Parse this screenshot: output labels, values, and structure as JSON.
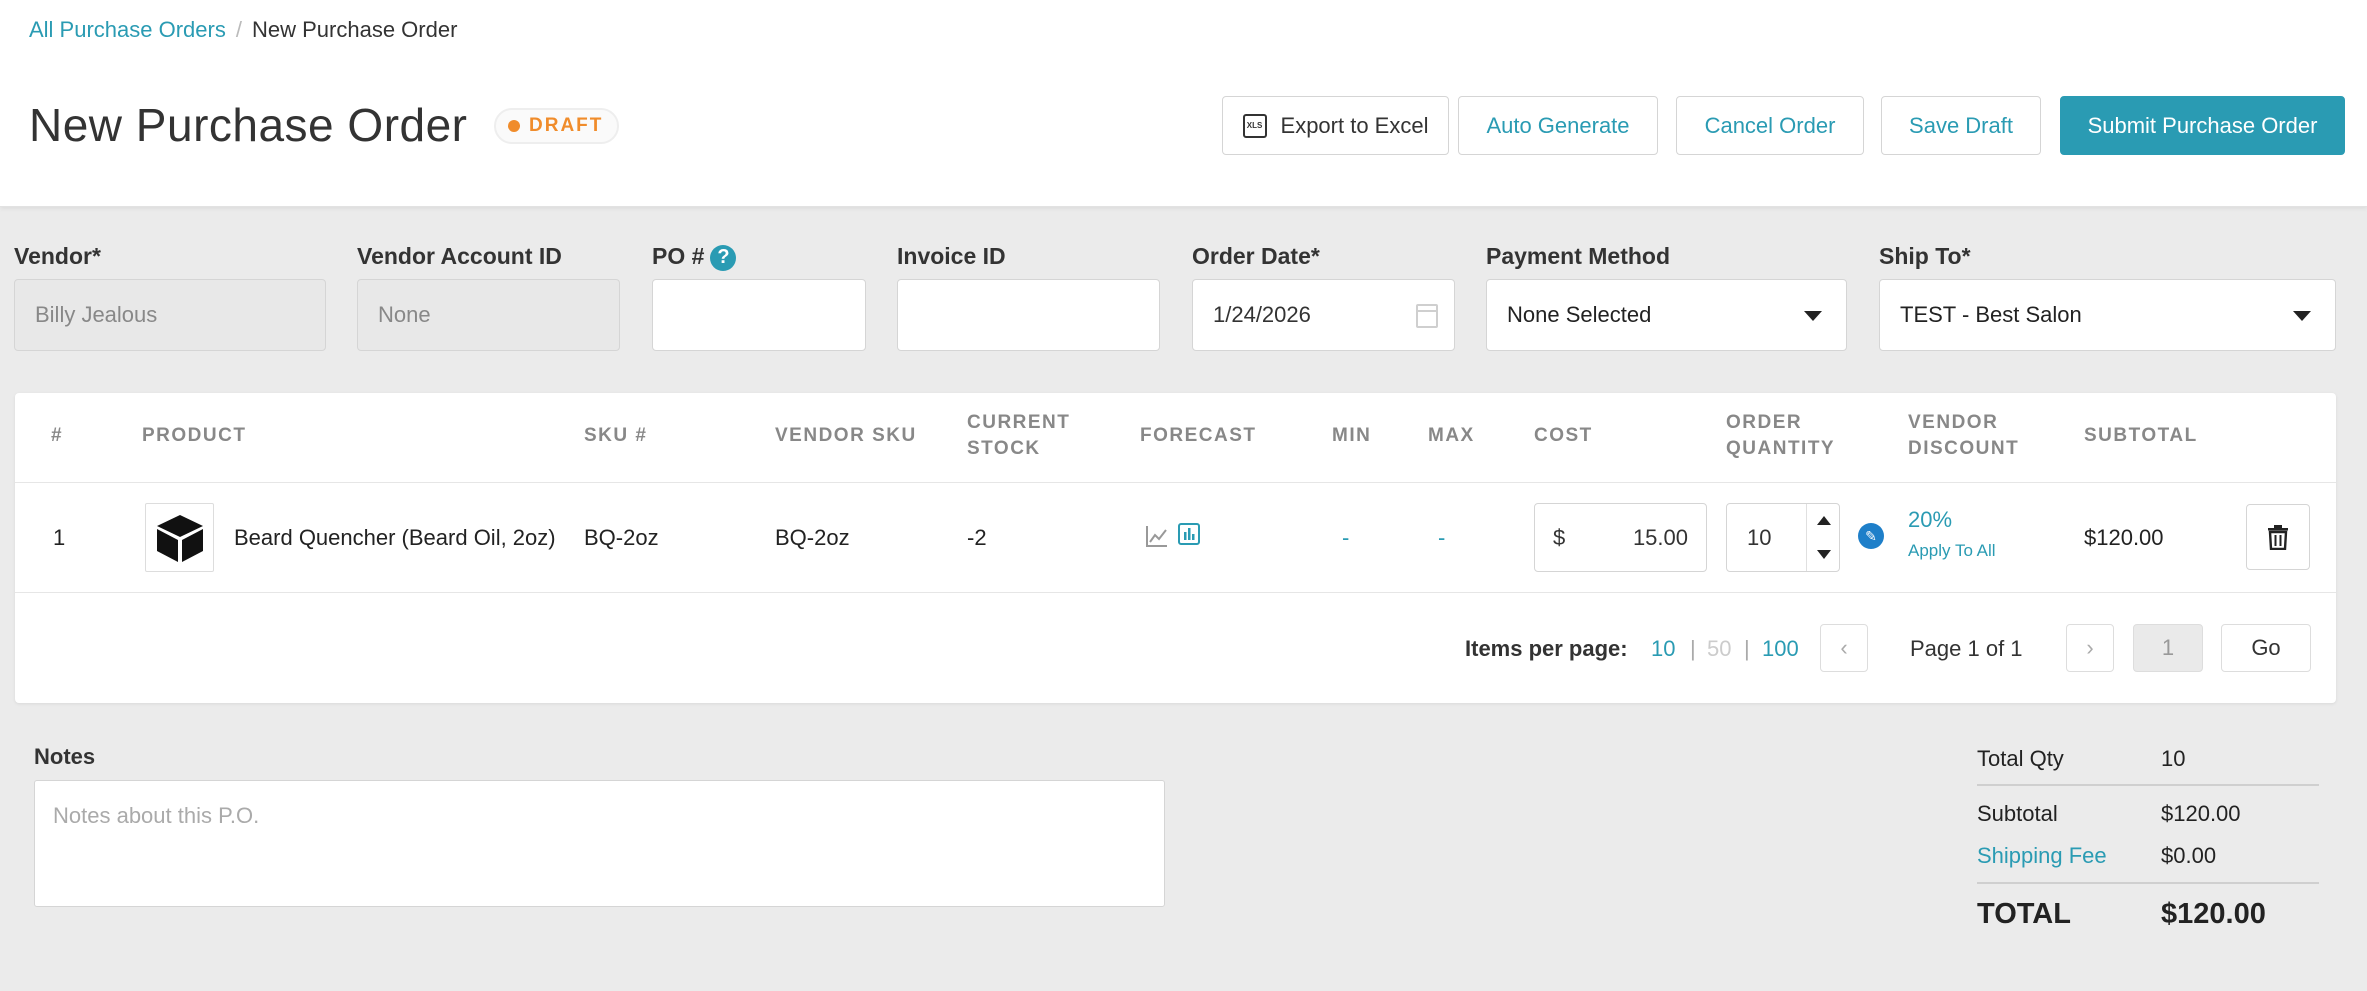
{
  "breadcrumb": {
    "link": "All Purchase Orders",
    "separator": "/",
    "current": "New Purchase Order"
  },
  "page": {
    "title": "New Purchase Order",
    "status": "DRAFT"
  },
  "toolbar": {
    "export": "Export to Excel",
    "auto": "Auto Generate",
    "cancel": "Cancel Order",
    "save": "Save Draft",
    "submit": "Submit Purchase Order"
  },
  "form": {
    "vendor": {
      "label": "Vendor*",
      "value": "Billy Jealous"
    },
    "account": {
      "label": "Vendor Account ID",
      "value": "None"
    },
    "po": {
      "label": "PO #",
      "value": ""
    },
    "invoice": {
      "label": "Invoice ID",
      "value": ""
    },
    "date": {
      "label": "Order Date*",
      "value": "1/24/2026"
    },
    "payment": {
      "label": "Payment Method",
      "value": "None Selected"
    },
    "shipto": {
      "label": "Ship To*",
      "value": "TEST - Best Salon"
    }
  },
  "table": {
    "headers": {
      "num": "#",
      "product": "PRODUCT",
      "sku": "SKU #",
      "vsku": "VENDOR SKU",
      "stock1": "CURRENT",
      "stock2": "STOCK",
      "forecast": "FORECAST",
      "min": "MIN",
      "max": "MAX",
      "cost": "COST",
      "qty1": "ORDER",
      "qty2": "QUANTITY",
      "disc1": "VENDOR",
      "disc2": "DISCOUNT",
      "subtotal": "SUBTOTAL"
    },
    "rows": [
      {
        "num": "1",
        "product": "Beard Quencher (Beard Oil, 2oz)",
        "sku": "BQ-2oz",
        "vsku": "BQ-2oz",
        "stock": "-2",
        "min": "-",
        "max": "-",
        "currency": "$",
        "cost": "15.00",
        "qty": "10",
        "discount": "20%",
        "apply": "Apply To All",
        "subtotal": "$120.00"
      }
    ]
  },
  "pagination": {
    "label": "Items per page:",
    "opt10": "10",
    "opt50": "50",
    "opt100": "100",
    "sep": "|",
    "page_text": "Page 1 of 1",
    "page_input": "1",
    "go": "Go"
  },
  "notes": {
    "label": "Notes",
    "placeholder": "Notes about this P.O."
  },
  "summary": {
    "qty_label": "Total Qty",
    "qty": "10",
    "subtotal_label": "Subtotal",
    "subtotal": "$120.00",
    "shipping_label": "Shipping Fee",
    "shipping": "$0.00",
    "total_label": "TOTAL",
    "total": "$120.00"
  },
  "colors": {
    "accent": "#2a9bb3",
    "draft": "#f08c2b",
    "edit": "#1e7fc9"
  }
}
